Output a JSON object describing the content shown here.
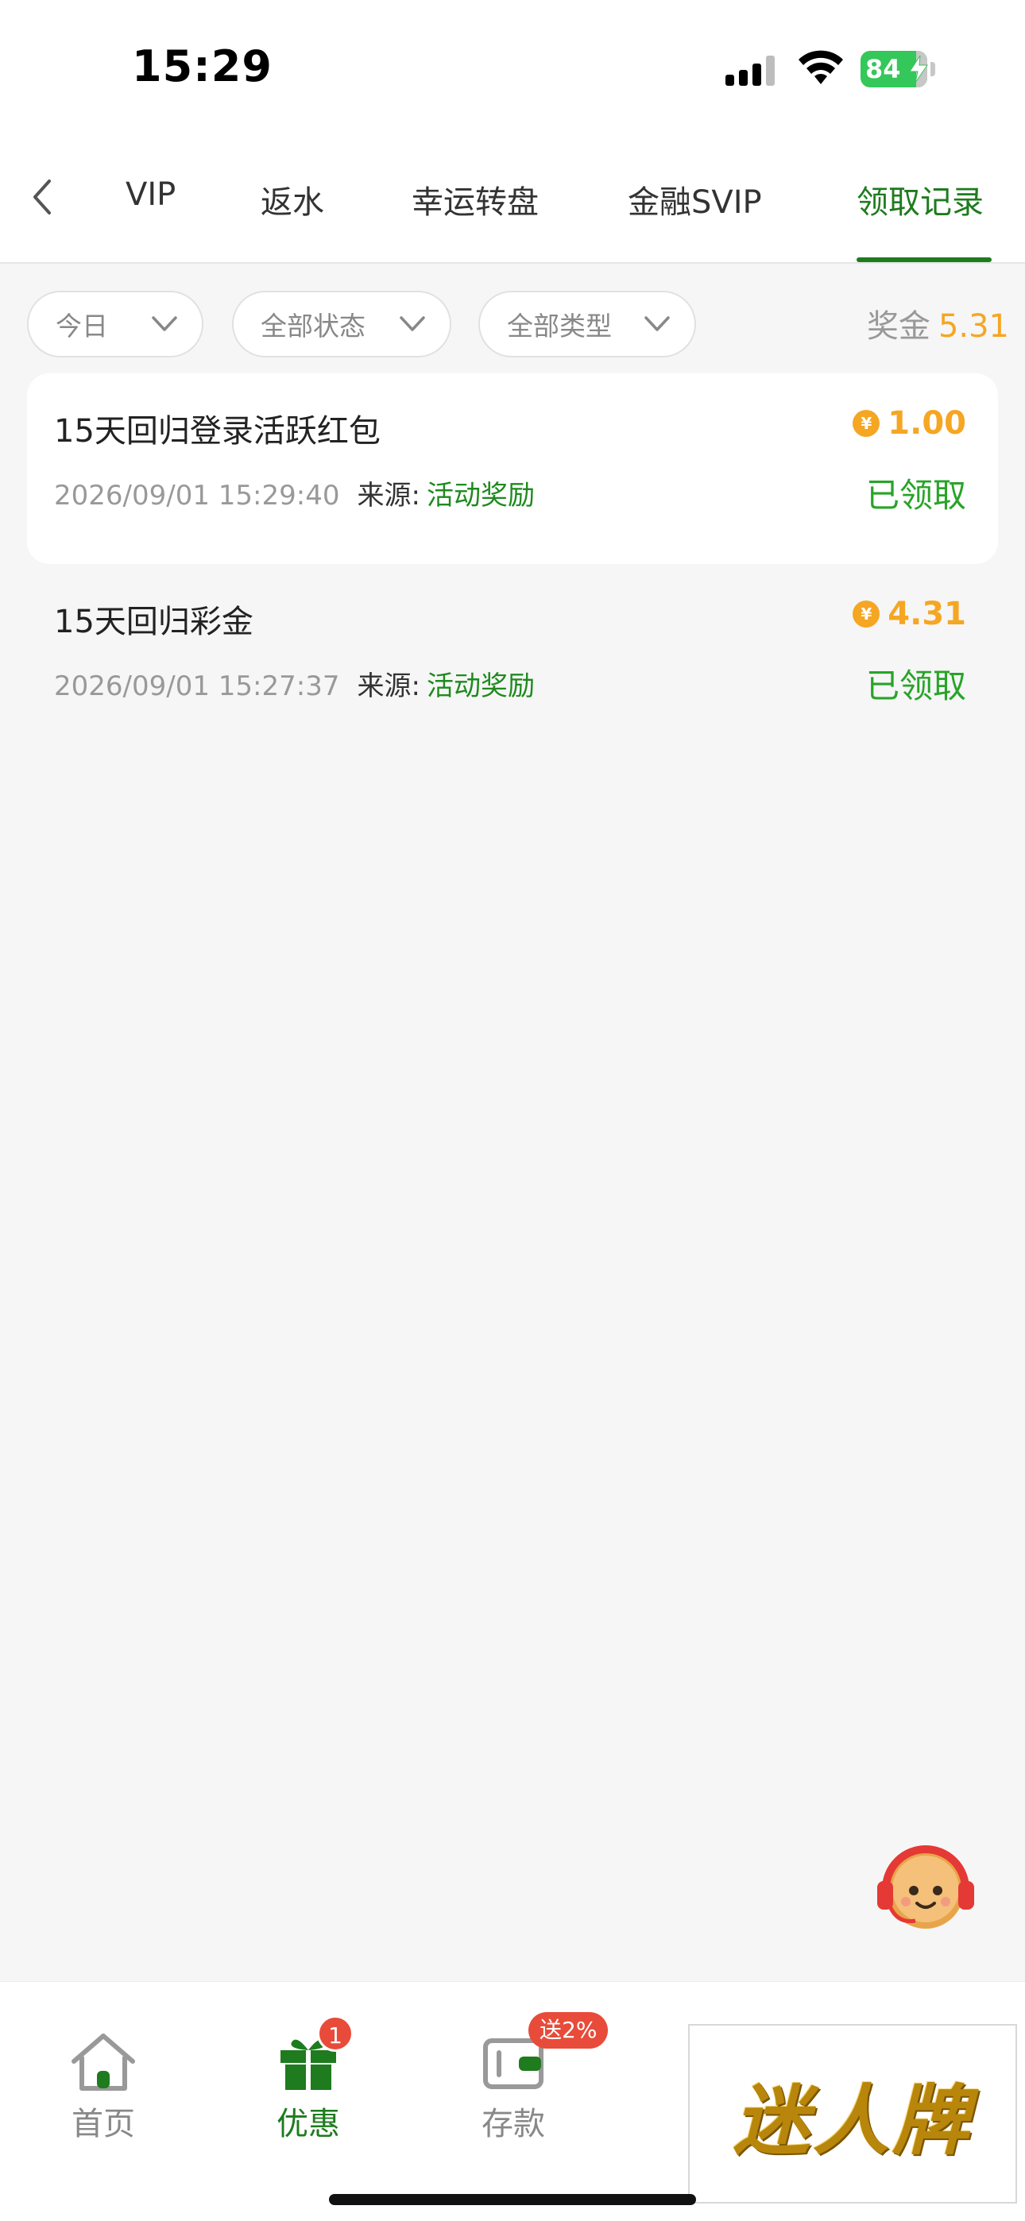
{
  "status_bar": {
    "time": "15:29",
    "battery": "84"
  },
  "nav": {
    "tabs": [
      {
        "label": "VIP",
        "active": false
      },
      {
        "label": "返水",
        "active": false
      },
      {
        "label": "幸运转盘",
        "active": false
      },
      {
        "label": "金融SVIP",
        "active": false
      },
      {
        "label": "领取记录",
        "active": true
      }
    ]
  },
  "filters": {
    "date": "今日",
    "status": "全部状态",
    "type": "全部类型"
  },
  "bonus_summary": {
    "label": "奖金",
    "value": "5.31"
  },
  "records": [
    {
      "title": "15天回归登录活跃红包",
      "amount": "1.00",
      "time": "2026/09/01 15:29:40",
      "source_label": "来源:",
      "source": "活动奖励",
      "status": "已领取"
    },
    {
      "title": "15天回归彩金",
      "amount": "4.31",
      "time": "2026/09/01 15:27:37",
      "source_label": "来源:",
      "source": "活动奖励",
      "status": "已领取"
    }
  ],
  "currency_symbol": "¥",
  "bottom_nav": {
    "items": [
      {
        "label": "首页",
        "icon": "home-icon",
        "active": false
      },
      {
        "label": "优惠",
        "icon": "gift-icon",
        "active": true,
        "badge": "1"
      },
      {
        "label": "存款",
        "icon": "wallet-icon",
        "active": false,
        "badge": "送2%"
      }
    ]
  },
  "watermark": "迷人牌",
  "colors": {
    "accent": "#1e7b1e",
    "gold": "#f5a623",
    "claimed": "#28a428",
    "badge": "#e84b3a"
  }
}
